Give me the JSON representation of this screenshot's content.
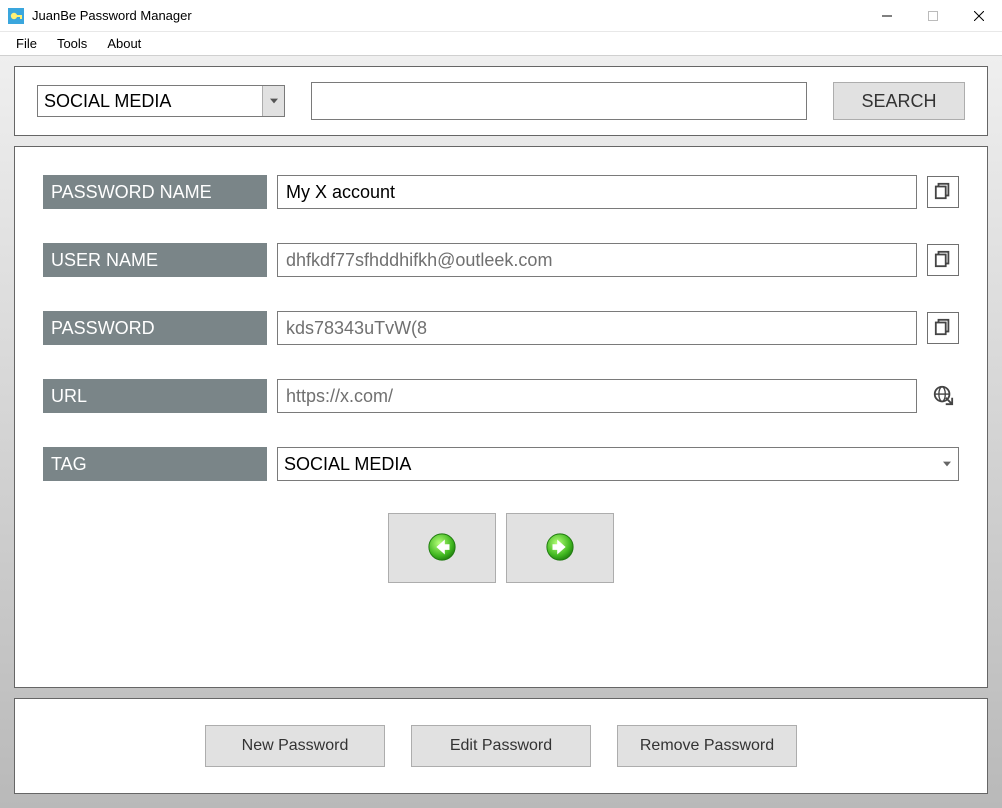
{
  "window": {
    "title": "JuanBe Password Manager"
  },
  "menu": {
    "file": "File",
    "tools": "Tools",
    "about": "About"
  },
  "search": {
    "category": "SOCIAL MEDIA",
    "query": "",
    "button": "SEARCH"
  },
  "fields": {
    "password_name": {
      "label": "PASSWORD NAME",
      "value": "My X account"
    },
    "user_name": {
      "label": "USER NAME",
      "value": "dhfkdf77sfhddhifkh@outleek.com"
    },
    "password": {
      "label": "PASSWORD",
      "value": "kds78343uTvW(8"
    },
    "url": {
      "label": "URL",
      "value": "https://x.com/"
    },
    "tag": {
      "label": "TAG",
      "value": "SOCIAL MEDIA"
    }
  },
  "actions": {
    "new": "New Password",
    "edit": "Edit Password",
    "remove": "Remove Password"
  }
}
